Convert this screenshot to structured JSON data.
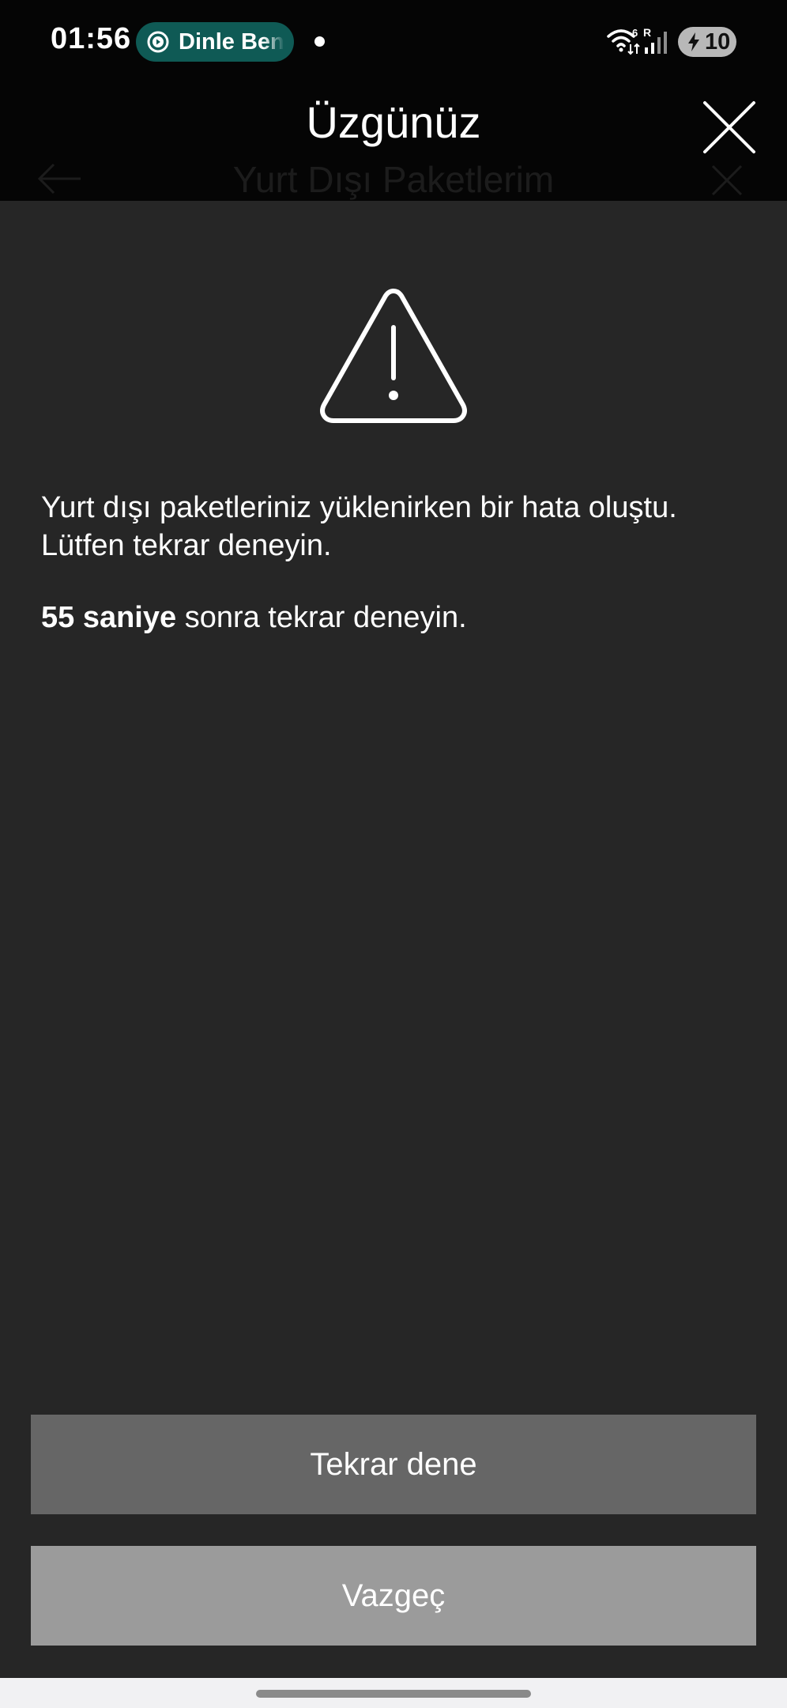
{
  "status_bar": {
    "time": "01:56",
    "media_pill_label": "Dinle Ben",
    "battery_level": "10",
    "icons": [
      "play-icon",
      "wifi-icon",
      "signal-icon",
      "battery-charging-icon"
    ]
  },
  "background_page": {
    "title": "Yurt Dışı Paketlerim"
  },
  "dialog": {
    "title": "Üzgünüz",
    "icon": "warning-triangle-icon",
    "message_line1": "Yurt dışı paketleriniz yüklenirken bir hata oluştu.",
    "message_line2": "Lütfen tekrar deneyin.",
    "countdown_bold": "55 saniye",
    "countdown_rest": " sonra tekrar deneyin.",
    "retry_label": "Tekrar dene",
    "cancel_label": "Vazgeç"
  },
  "colors": {
    "background": "#262626",
    "header": "#050505",
    "retry_button": "#666666",
    "cancel_button": "#9b9b9b",
    "media_pill": "#0f5a55"
  }
}
